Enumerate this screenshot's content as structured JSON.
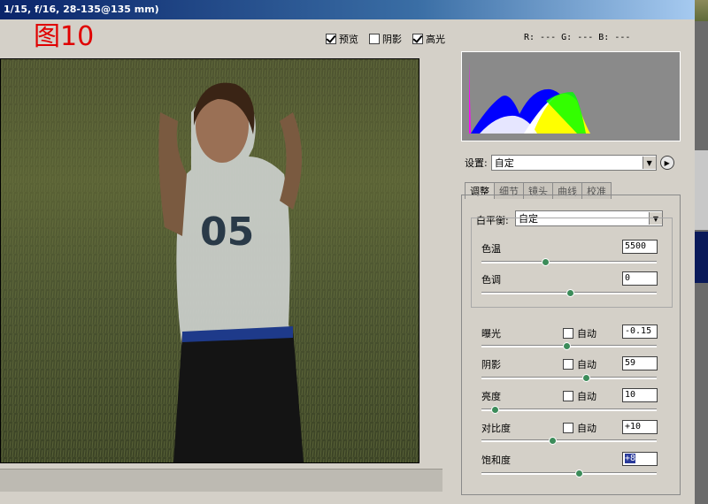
{
  "window": {
    "title": "1/15, f/16, 28-135@135 mm)"
  },
  "figure_label": "图10",
  "options": {
    "preview": {
      "label": "预览",
      "checked": true
    },
    "shadow": {
      "label": "阴影",
      "checked": false
    },
    "highlight": {
      "label": "高光",
      "checked": true
    }
  },
  "rgb_readout": "R: ---  G: ---  B: ---",
  "settings": {
    "label": "设置:",
    "value": "自定"
  },
  "tabs": [
    "调整",
    "细节",
    "镜头",
    "曲线",
    "校准"
  ],
  "white_balance": {
    "label": "白平衡:",
    "value": "自定",
    "temperature": {
      "label": "色温",
      "value": "5500",
      "slider": 0.36
    },
    "tint": {
      "label": "色调",
      "value": "0",
      "slider": 0.5
    }
  },
  "adjustments": [
    {
      "label": "曝光",
      "auto": "自动",
      "value": "-0.15",
      "slider": 0.48
    },
    {
      "label": "阴影",
      "auto": "自动",
      "value": "59",
      "slider": 0.59
    },
    {
      "label": "亮度",
      "auto": "自动",
      "value": "10",
      "slider": 0.07
    },
    {
      "label": "对比度",
      "auto": "自动",
      "value": "+10",
      "slider": 0.4
    },
    {
      "label": "饱和度",
      "value": "+8",
      "slider": 0.55
    }
  ],
  "colors": {
    "title_bar": "#0a246a",
    "figure_label": "#e00000",
    "slider_thumb": "#3c8c5a"
  }
}
